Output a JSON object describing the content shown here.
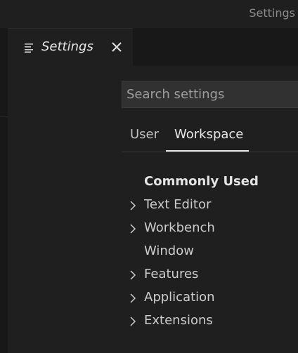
{
  "window": {
    "title": "Settings"
  },
  "tab": {
    "label": "Settings",
    "icon": "settings-editor-icon",
    "close_icon": "close-icon"
  },
  "search": {
    "placeholder": "Search settings",
    "value": ""
  },
  "scope_tabs": [
    {
      "label": "User",
      "selected": false
    },
    {
      "label": "Workspace",
      "selected": true
    }
  ],
  "toc": [
    {
      "label": "Commonly Used",
      "expandable": false,
      "bold": true
    },
    {
      "label": "Text Editor",
      "expandable": true
    },
    {
      "label": "Workbench",
      "expandable": true
    },
    {
      "label": "Window",
      "expandable": false
    },
    {
      "label": "Features",
      "expandable": true
    },
    {
      "label": "Application",
      "expandable": true
    },
    {
      "label": "Extensions",
      "expandable": true
    }
  ],
  "colors": {
    "background": "#1f1f1f",
    "tabstrip": "#181818",
    "search_bg": "#313131",
    "text": "#cccccc"
  }
}
